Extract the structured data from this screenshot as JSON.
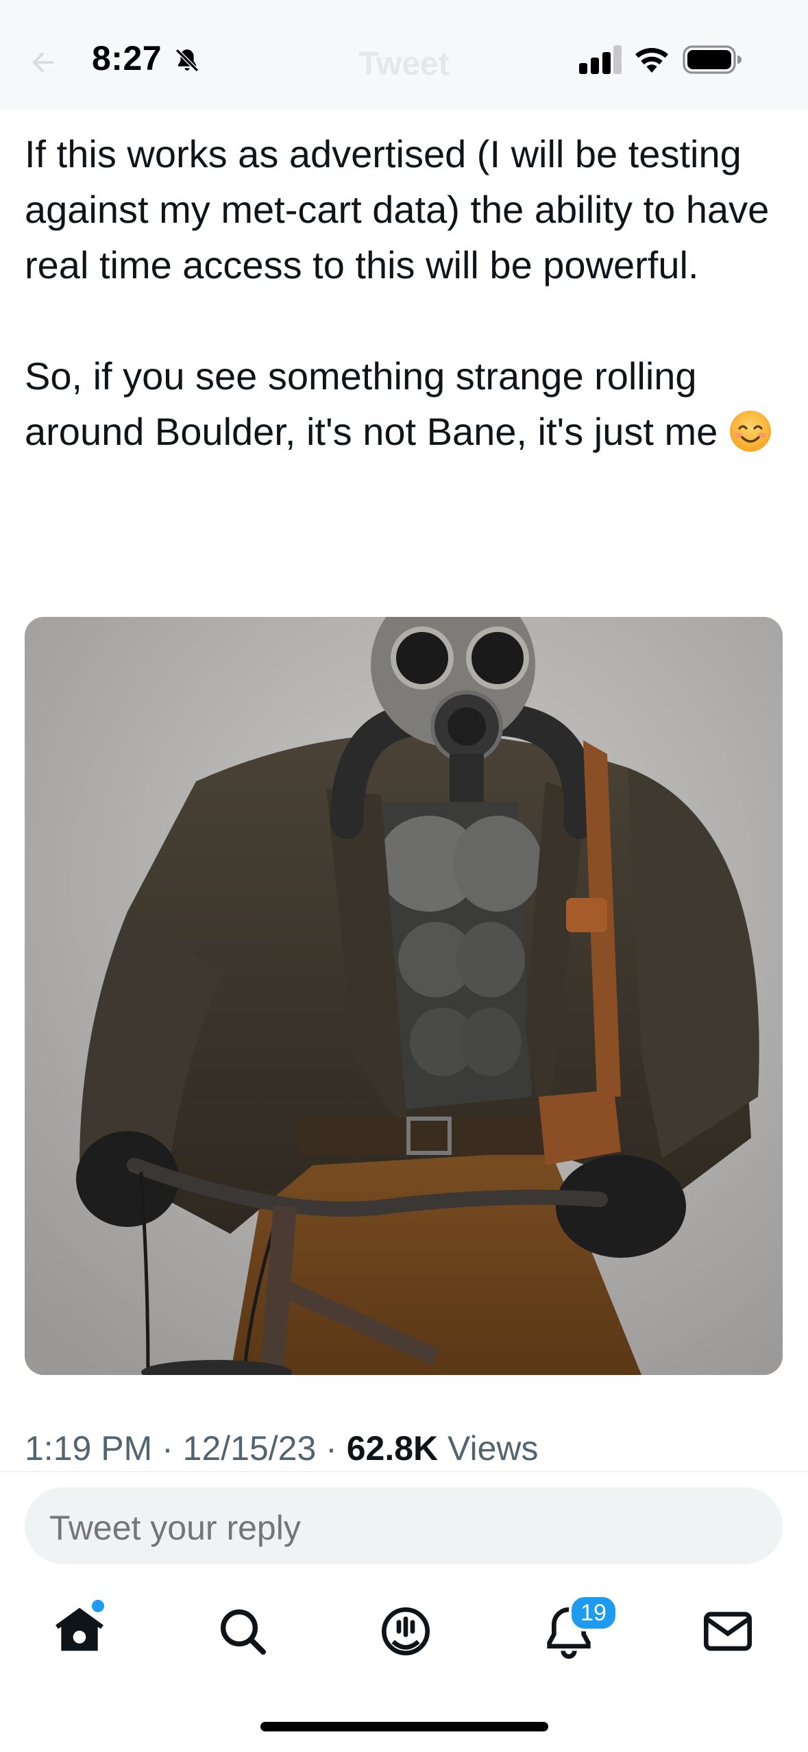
{
  "status_bar": {
    "time": "8:27",
    "icons": [
      "bell-slash-icon",
      "cellular-signal-icon",
      "wifi-icon",
      "battery-icon"
    ]
  },
  "header": {
    "title": "Tweet",
    "back_icon": "arrow-left-icon"
  },
  "tweet": {
    "text_paragraph_1": "If this works as advertised (I will be testing against my met-cart data) the ability to have real time access to this will be powerful.",
    "text_paragraph_2": "So, if you see something strange rolling around Boulder, it's not Bane, it's just me",
    "emoji": "smiling-face-icon",
    "timestamp": "1:19 PM · 12/15/23 · ",
    "views_count": "62.8K",
    "views_label": " Views"
  },
  "reply": {
    "placeholder": "Tweet your reply"
  },
  "tab_bar": {
    "items": [
      "home-icon",
      "search-icon",
      "spaces-icon",
      "notifications-icon",
      "messages-icon"
    ],
    "notifications_badge": "19",
    "accent_color": "#1d9bf0"
  }
}
